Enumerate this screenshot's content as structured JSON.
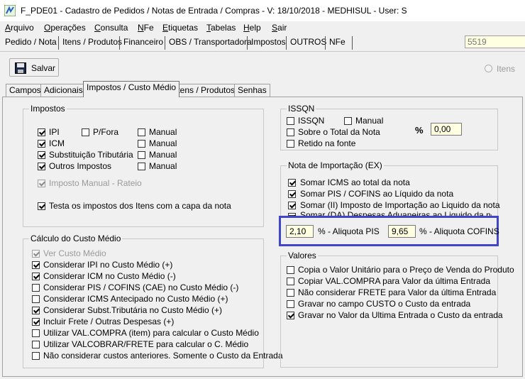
{
  "window": {
    "title": "F_PDE01 - Cadastro de Pedidos / Notas de Entrada / Compras - V: 18/10/2018 - MEDHISUL - User: S"
  },
  "menu": [
    {
      "label": "Arquivo",
      "u": "A",
      "rest": "rquivo"
    },
    {
      "label": "Operações",
      "u": "O",
      "rest": "perações"
    },
    {
      "label": "Consulta",
      "u": "C",
      "rest": "onsulta"
    },
    {
      "label": "NFe",
      "u": "N",
      "rest": "Fe"
    },
    {
      "label": "Etiquetas",
      "u": "E",
      "rest": "tiquetas"
    },
    {
      "label": "Tabelas",
      "u": "T",
      "rest": "abelas"
    },
    {
      "label": "Help",
      "u": "H",
      "rest": "elp"
    },
    {
      "label": "Sair",
      "u": "S",
      "rest": "air"
    }
  ],
  "top_tabs": [
    "Pedido / Nota",
    "Itens / Produtos",
    "Financeiro",
    "OBS / Transportadora",
    "Impostos",
    "OUTROS",
    "NFe"
  ],
  "code_field": "5519",
  "toolbar": {
    "save_label": "Salvar",
    "itens_label": "Itens"
  },
  "sub_tabs": [
    "Campos",
    "Adicionais",
    "Impostos / Custo Médio",
    "Itens / Produtos",
    "Senhas"
  ],
  "impostos": {
    "title": "Impostos",
    "ipi": "IPI",
    "pfora": "P/Fora",
    "manual1": "Manual",
    "icm": "ICM",
    "manual2": "Manual",
    "subst": "Substituição Tributária",
    "manual3": "Manual",
    "outros": "Outros Impostos",
    "manual4": "Manual",
    "rateio": "Imposto Manual - Rateio",
    "testa": "Testa os impostos dos Itens com a capa da nota"
  },
  "custo": {
    "title": "Cálculo do Custo Médio",
    "items": [
      {
        "label": "Ver Custo Médio",
        "checked": true,
        "disabled": true
      },
      {
        "label": "Considerar IPI no Custo Médio (+)",
        "checked": true
      },
      {
        "label": "Considerar ICM no Custo Médio (-)",
        "checked": true
      },
      {
        "label": "Considerar PIS / COFINS (CAE) no Custo Médio (-)",
        "checked": false
      },
      {
        "label": "Considerar ICMS Antecipado no Custo Médio (+)",
        "checked": false
      },
      {
        "label": "Considerar Subst.Tributária no Custo Médio (+)",
        "checked": true
      },
      {
        "label": "Incluir Frete / Outras Despesas (+)",
        "checked": true
      },
      {
        "label": "Utilizar VAL.COMPRA (item) para calcular o Custo Médio",
        "checked": false
      },
      {
        "label": "Utilizar VALCOBRAR/FRETE para calcular o C. Médio",
        "checked": false
      },
      {
        "label": "Não considerar custos anteriores.  Somente o Custo da Entrada",
        "checked": false
      }
    ]
  },
  "issqn": {
    "title": "ISSQN",
    "issqn": "ISSQN",
    "manual": "Manual",
    "sobre": "Sobre o Total da Nota",
    "pct": "%",
    "value": "0,00",
    "retido": "Retido na fonte"
  },
  "importacao": {
    "title": "Nota de Importação (EX)",
    "items": [
      "Somar ICMS ao total da nota",
      "Somar PIS / COFINS ao Líquido da nota",
      "Somar (II) Imposto de Importação ao Liquido da nota",
      "Somar (DA) Despesas Aduaneiras ao Liquido da nota"
    ],
    "pis_value": "2,10",
    "pis_label": "% - Aliquota PIS",
    "cofins_value": "9,65",
    "cofins_label": "% - Aliquota COFINS"
  },
  "valores": {
    "title": "Valores",
    "items": [
      {
        "label": "Copia o Valor Unitário para o Preço de Venda do Produto",
        "checked": false
      },
      {
        "label": "Copiar VAL.COMPRA para Valor da última Entrada",
        "checked": false
      },
      {
        "label": "Não considerar FRETE para Valor da última Entrada",
        "checked": false
      },
      {
        "label": "Gravar no campo CUSTO o Custo da entrada",
        "checked": false
      },
      {
        "label": "Gravar no Valor da Ultima Entrada o Custo da entrada",
        "checked": true
      }
    ]
  },
  "colors": {
    "highlight": "#3f47c8",
    "field_bg": "#ffffe1"
  }
}
